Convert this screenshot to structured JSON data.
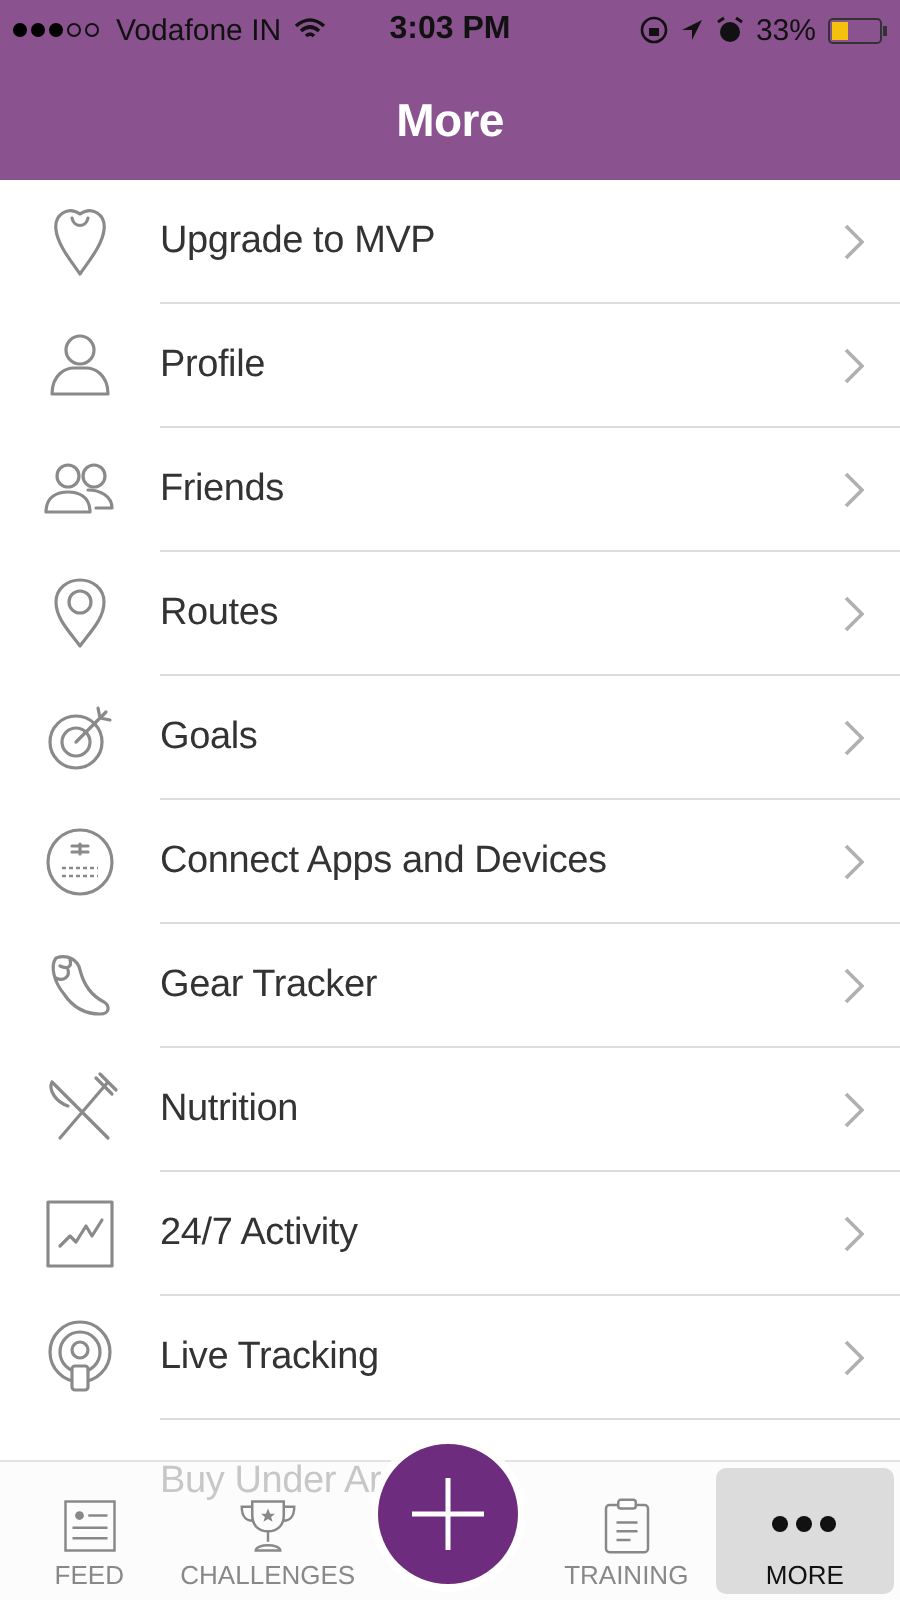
{
  "status_bar": {
    "carrier": "Vodafone IN",
    "time": "3:03 PM",
    "battery": "33%"
  },
  "header": {
    "title": "More"
  },
  "menu": [
    {
      "label": "Upgrade to MVP",
      "kind": "item"
    },
    {
      "label": "Profile",
      "kind": "item"
    },
    {
      "label": "Friends",
      "kind": "item"
    },
    {
      "label": "Routes",
      "kind": "item"
    },
    {
      "label": "Goals",
      "kind": "item"
    },
    {
      "label": "Connect Apps and Devices",
      "kind": "item"
    },
    {
      "label": "Gear Tracker",
      "kind": "item"
    },
    {
      "label": "Nutrition",
      "kind": "item"
    },
    {
      "label": "24/7 Activity",
      "kind": "item"
    },
    {
      "label": "Live Tracking",
      "kind": "item"
    },
    {
      "label": "Buy Under Ar",
      "kind": "covered"
    }
  ],
  "tabs": [
    {
      "label": "FEED",
      "selected": false
    },
    {
      "label": "CHALLENGES",
      "selected": false
    },
    {
      "label": "TRAINING",
      "selected": false
    },
    {
      "label": "MORE",
      "selected": true
    }
  ]
}
